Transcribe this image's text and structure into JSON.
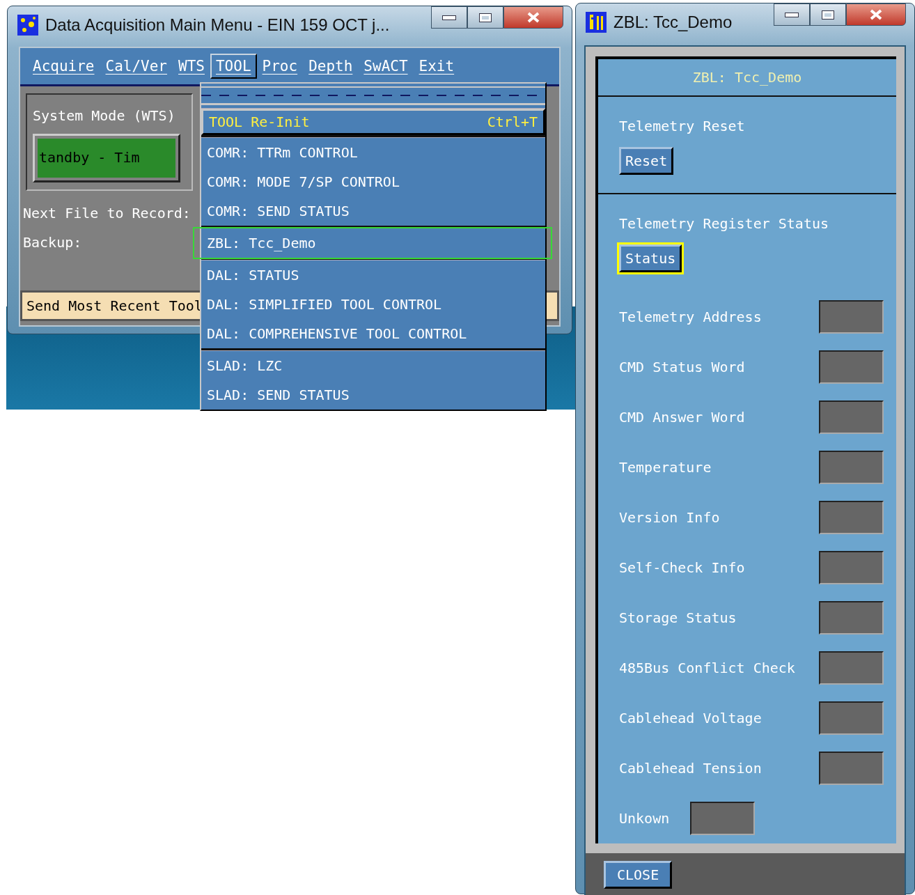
{
  "main_window": {
    "title": "Data Acquisition Main Menu - EIN 159 OCT j...",
    "menu_bar": [
      {
        "label": "Acquire",
        "selected": false
      },
      {
        "label": "Cal/Ver",
        "selected": false
      },
      {
        "label": "WTS",
        "selected": false
      },
      {
        "label": "TOOL",
        "selected": true
      },
      {
        "label": "Proc",
        "selected": false
      },
      {
        "label": "Depth",
        "selected": false
      },
      {
        "label": "SwACT",
        "selected": false
      },
      {
        "label": "Exit",
        "selected": false
      }
    ],
    "system_mode": {
      "label": "System Mode (WTS)",
      "value": "tandby - Tim"
    },
    "next_file_label": "Next File to Record:",
    "backup_label": "Backup:",
    "status_text": "Send Most Recent Tool"
  },
  "tool_menu": {
    "groups": [
      {
        "items": [
          {
            "label": "TOOL Re-Init",
            "shortcut": "Ctrl+T",
            "selected": true,
            "highlighted": false
          }
        ]
      },
      {
        "items": [
          {
            "label": "COMR: TTRm CONTROL",
            "selected": false,
            "highlighted": false
          },
          {
            "label": "COMR: MODE 7/SP CONTROL",
            "selected": false,
            "highlighted": false
          },
          {
            "label": "COMR: SEND STATUS",
            "selected": false,
            "highlighted": false
          }
        ]
      },
      {
        "items": [
          {
            "label": "ZBL: Tcc_Demo",
            "selected": false,
            "highlighted": true
          }
        ]
      },
      {
        "items": [
          {
            "label": "DAL: STATUS",
            "selected": false,
            "highlighted": false
          },
          {
            "label": "DAL: SIMPLIFIED TOOL CONTROL",
            "selected": false,
            "highlighted": false
          },
          {
            "label": "DAL: COMPREHENSIVE TOOL CONTROL",
            "selected": false,
            "highlighted": false
          }
        ]
      },
      {
        "items": [
          {
            "label": "SLAD: LZC",
            "selected": false,
            "highlighted": false
          },
          {
            "label": "SLAD: SEND STATUS",
            "selected": false,
            "highlighted": false
          }
        ]
      }
    ]
  },
  "zbl_window": {
    "title": "ZBL: Tcc_Demo",
    "panel_title": "ZBL: Tcc_Demo",
    "sections": [
      {
        "label": "Telemetry Reset",
        "button": "Reset",
        "focused": false
      },
      {
        "label": "Telemetry Register Status",
        "button": "Status",
        "focused": true
      }
    ],
    "readouts": [
      {
        "label": "Telemetry Address",
        "kind": "wide"
      },
      {
        "label": "CMD Status Word",
        "kind": "wide"
      },
      {
        "label": "CMD Answer Word",
        "kind": "wide"
      },
      {
        "label": "Temperature",
        "kind": "wide"
      },
      {
        "label": "Version Info",
        "kind": "wide"
      },
      {
        "label": "Self-Check Info",
        "kind": "wide"
      },
      {
        "label": "Storage Status",
        "kind": "wide"
      },
      {
        "label": "485Bus Conflict Check",
        "kind": "wide"
      },
      {
        "label": "Cablehead Voltage",
        "kind": "wide"
      },
      {
        "label": "Cablehead Tension",
        "kind": "wide"
      },
      {
        "label": "Unkown",
        "kind": "inline"
      }
    ],
    "close_button": "CLOSE"
  }
}
